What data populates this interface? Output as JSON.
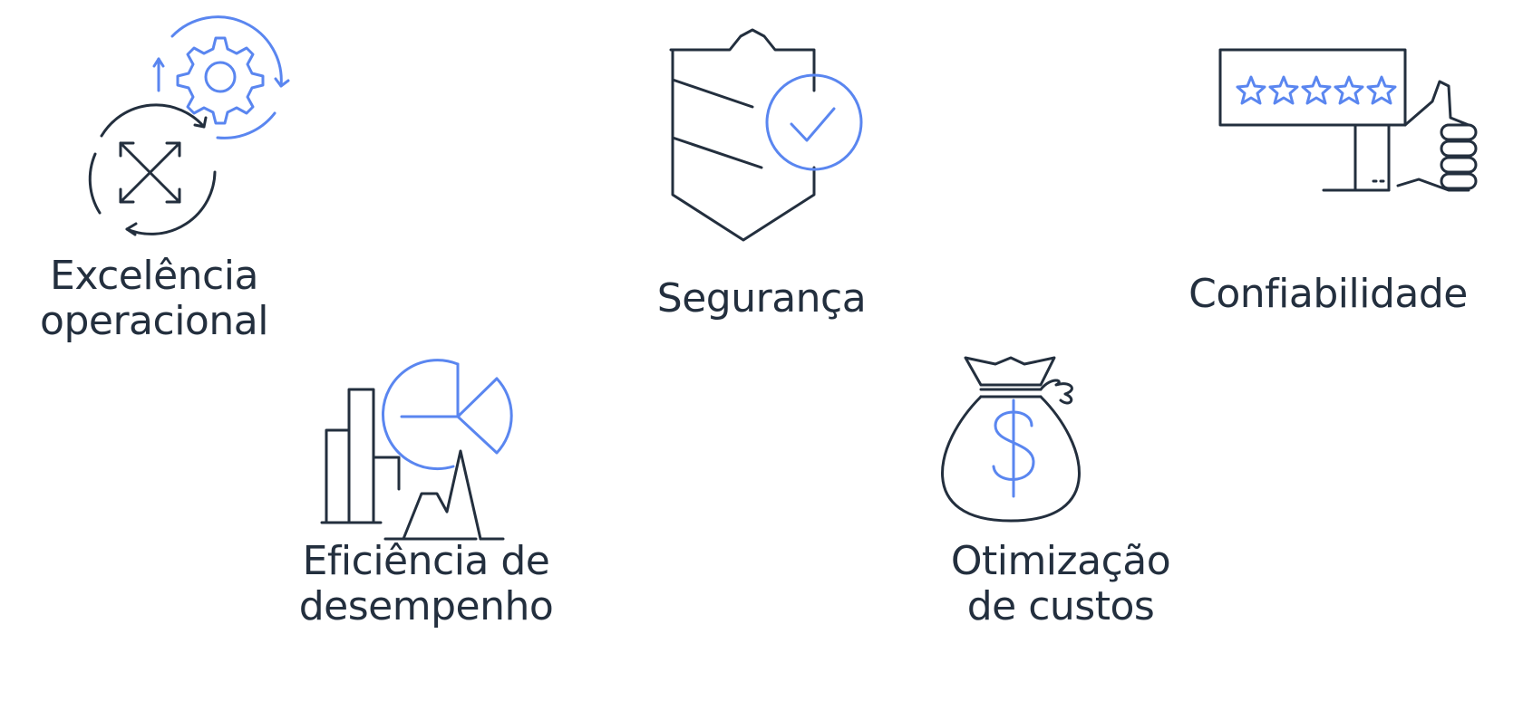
{
  "colors": {
    "dark": "#232f3e",
    "accent": "#5a86f0"
  },
  "pillars": {
    "operational": {
      "icon": "gears-arrows-icon",
      "line1": "Excelência",
      "line2": "operacional"
    },
    "security": {
      "icon": "shield-check-icon",
      "line1": "Segurança"
    },
    "reliability": {
      "icon": "thumbs-up-stars-icon",
      "line1": "Confiabilidade"
    },
    "performance": {
      "icon": "charts-icon",
      "line1": "Eficiência de",
      "line2": "desempenho"
    },
    "cost": {
      "icon": "money-bag-icon",
      "line1": "Otimização",
      "line2": "de custos"
    }
  }
}
